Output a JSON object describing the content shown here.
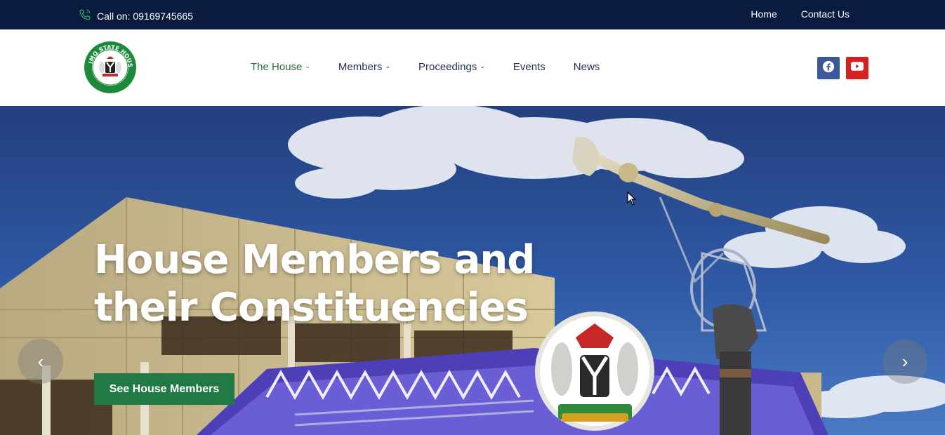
{
  "topbar": {
    "call_text": "Call on: 09169745665",
    "links": [
      "Home",
      "Contact Us"
    ]
  },
  "header": {
    "logo_text": "IMO STATE HOUSE OF ASSEMBLY",
    "nav": [
      {
        "label": "The House",
        "has_dropdown": true,
        "active": true
      },
      {
        "label": "Members",
        "has_dropdown": true,
        "active": false
      },
      {
        "label": "Proceedings",
        "has_dropdown": true,
        "active": false
      },
      {
        "label": "Events",
        "has_dropdown": false,
        "active": false
      },
      {
        "label": "News",
        "has_dropdown": false,
        "active": false
      }
    ],
    "social": [
      "facebook-icon",
      "youtube-icon"
    ]
  },
  "hero": {
    "title": "House Members and their Constituencies",
    "button_label": "See House Members",
    "prev_icon": "chevron-left-icon",
    "next_icon": "chevron-right-icon"
  },
  "colors": {
    "topbar_bg": "#0b1a3f",
    "accent_green": "#217a45",
    "nav_active": "#2a6a3a",
    "facebook": "#3b5998",
    "youtube": "#d32222"
  }
}
